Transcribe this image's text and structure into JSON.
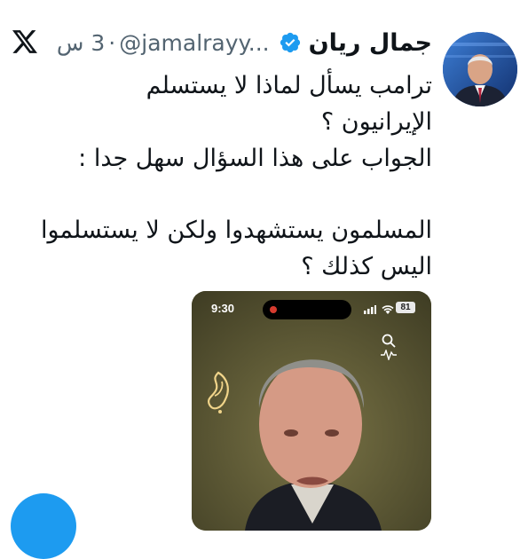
{
  "tweet": {
    "author": {
      "display_name": "جمال ريان",
      "handle": "@jamalrayy...",
      "verified": true
    },
    "time": "3 س",
    "separator": "·",
    "platform_icon": "x-logo-icon",
    "text_lines": [
      "ترامب يسأل لماذا لا يستسلم",
      "الإيرانيون ؟",
      "الجواب على هذا السؤال سهل جدا :",
      "",
      "المسلمون يستشهدوا ولكن لا يستسلموا",
      "اليس كذلك ؟"
    ],
    "media": {
      "status_time": "9:30",
      "battery": "81",
      "icons": [
        "search-icon",
        "audio-wave-icon",
        "al-jazeera-logo"
      ]
    }
  },
  "colors": {
    "text": "#0f1419",
    "muted": "#536471",
    "verified": "#1d9bf0",
    "media_bg": "#5e5a34"
  }
}
